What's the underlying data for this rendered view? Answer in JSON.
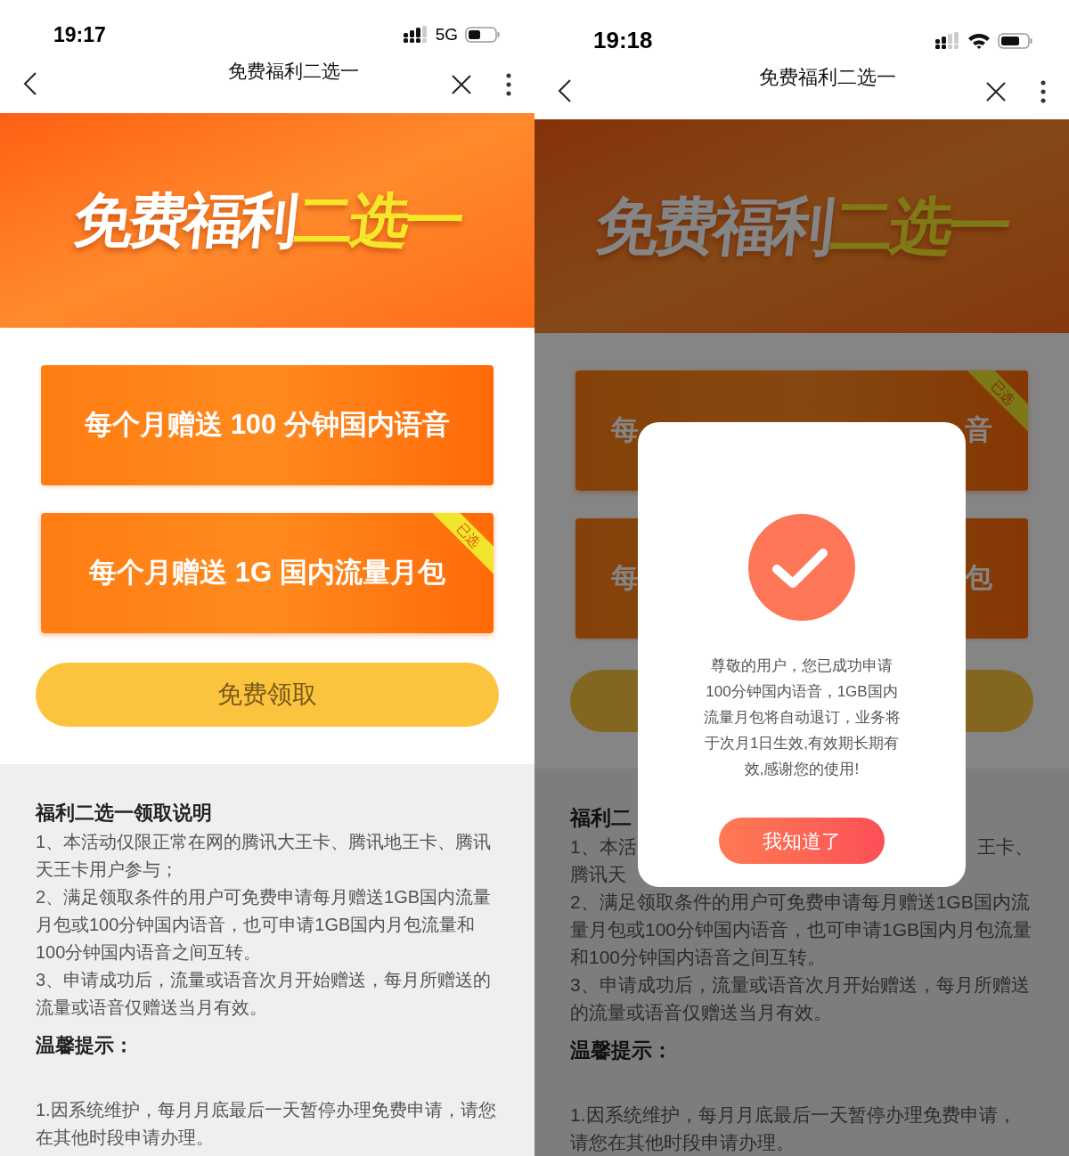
{
  "phones": [
    {
      "status_bar": {
        "time": "19:17",
        "network": "5G",
        "wifi": false
      },
      "nav": {
        "title": "免费福利二选一"
      },
      "banner": {
        "white": "免费福利",
        "yellow": "二选一"
      },
      "options": [
        {
          "kind": "full",
          "label": "每个月赠送 100 分钟国内语音",
          "selected": false
        },
        {
          "kind": "full",
          "label": "每个月赠送 1G 国内流量月包",
          "selected": true
        }
      ],
      "selected_tag": "已选",
      "claim_button": {
        "label": "免费领取"
      },
      "instructions": {
        "title": "福利二选一领取说明",
        "items": [
          {
            "kind": "full",
            "text": "1、本活动仅限正常在网的腾讯大王卡、腾讯地王卡、腾讯天王卡用户参与；"
          },
          {
            "kind": "full",
            "text": "2、满足领取条件的用户可免费申请每月赠送1GB国内流量月包或100分钟国内语音，也可申请1GB国内月包流量和100分钟国内语音之间互转。"
          },
          {
            "kind": "full",
            "text": "3、申请成功后，流量或语音次月开始赠送，每月所赠送的流量或语音仅赠送当月有效。"
          }
        ]
      },
      "tips": {
        "title": "温馨提示：",
        "items": [
          "1.因系统维护，每月月底最后一天暂停办理免费申请，请您在其他时段申请办理。"
        ]
      }
    },
    {
      "status_bar": {
        "time": "19:18",
        "wifi": true
      },
      "nav": {
        "title": "免费福利二选一"
      },
      "banner": {
        "white": "免费福利",
        "yellow": "二选一"
      },
      "options": [
        {
          "kind": "split",
          "left": "每",
          "right": "音",
          "selected": true
        },
        {
          "kind": "split",
          "left": "每",
          "right": "包",
          "selected": false
        }
      ],
      "selected_tag": "已选",
      "instructions": {
        "title": "福利二",
        "items": [
          {
            "kind": "split",
            "left": "1、本活",
            "right": "王卡、"
          },
          {
            "kind": "split",
            "left": "腾讯天"
          },
          {
            "kind": "full",
            "text": "2、满足领取条件的用户可免费申请每月赠送1GB国内流量月包或100分钟国内语音，也可申请1GB国内月包流量和100分钟国内语音之间互转。"
          },
          {
            "kind": "full",
            "text": "3、申请成功后，流量或语音次月开始赠送，每月所赠送的流量或语音仅赠送当月有效。"
          }
        ]
      },
      "tips": {
        "title": "温馨提示：",
        "items": [
          "1.因系统维护，每月月底最后一天暂停办理免费申请，请您在其他时段申请办理。"
        ]
      },
      "dialog": {
        "message": "尊敬的用户，您已成功申请100分钟国内语音，1GB国内流量月包将自动退订，业务将于次月1日生效,有效期长期有效,感谢您的使用!",
        "button": "我知道了"
      }
    }
  ]
}
